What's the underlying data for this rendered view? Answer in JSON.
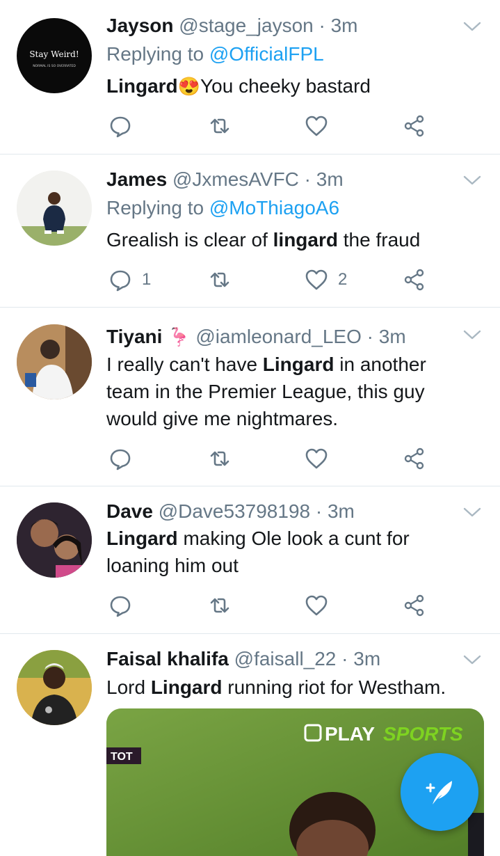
{
  "tweets": [
    {
      "name": "Jayson",
      "handle": "@stage_jayson",
      "time": "· 3m",
      "replying_prefix": "Replying to ",
      "replying_to": "@OfficialFPL",
      "text_bold": "Lingard",
      "text_emoji": "😍",
      "text_rest": "You cheeky bastard",
      "avatar_text": "Stay Weird!",
      "avatar_subtext": "NORMAL IS SO OVERRATED",
      "reply_count": "",
      "like_count": ""
    },
    {
      "name": "James",
      "handle": "@JxmesAVFC",
      "time": "· 3m",
      "replying_prefix": "Replying to ",
      "replying_to": "@MoThiagoA6",
      "text_pre": "Grealish is clear of ",
      "text_bold": "lingard",
      "text_post": " the fraud",
      "reply_count": "1",
      "like_count": "2"
    },
    {
      "name": "Tiyani",
      "name_emoji": "🦩",
      "handle": "@iamleonard_LEO",
      "time": "· 3m",
      "text_pre": "I really can't have ",
      "text_bold": "Lingard",
      "text_post": " in another team in the Premier League, this guy would give me nightmares."
    },
    {
      "name": "Dave",
      "handle": "@Dave53798198",
      "time": "· 3m",
      "text_bold": "Lingard",
      "text_post": " making Ole look a cunt for loaning him out"
    },
    {
      "name": "Faisal khalifa",
      "handle": "@faisall_22",
      "time": "· 3m",
      "text_pre": "Lord ",
      "text_bold": "Lingard",
      "text_post": " running riot for Westham.",
      "media_logo": "PLAYSPORTS",
      "media_logo_a": "PLAY",
      "media_logo_b": "SPORTS",
      "media_score": "TOT"
    }
  ],
  "colors": {
    "accent": "#1da1f2",
    "secondary_text": "#657786",
    "divider": "#e1e8ed"
  },
  "icons": [
    "reply-icon",
    "retweet-icon",
    "like-icon",
    "share-icon",
    "chevron-down-icon",
    "compose-tweet-icon"
  ]
}
